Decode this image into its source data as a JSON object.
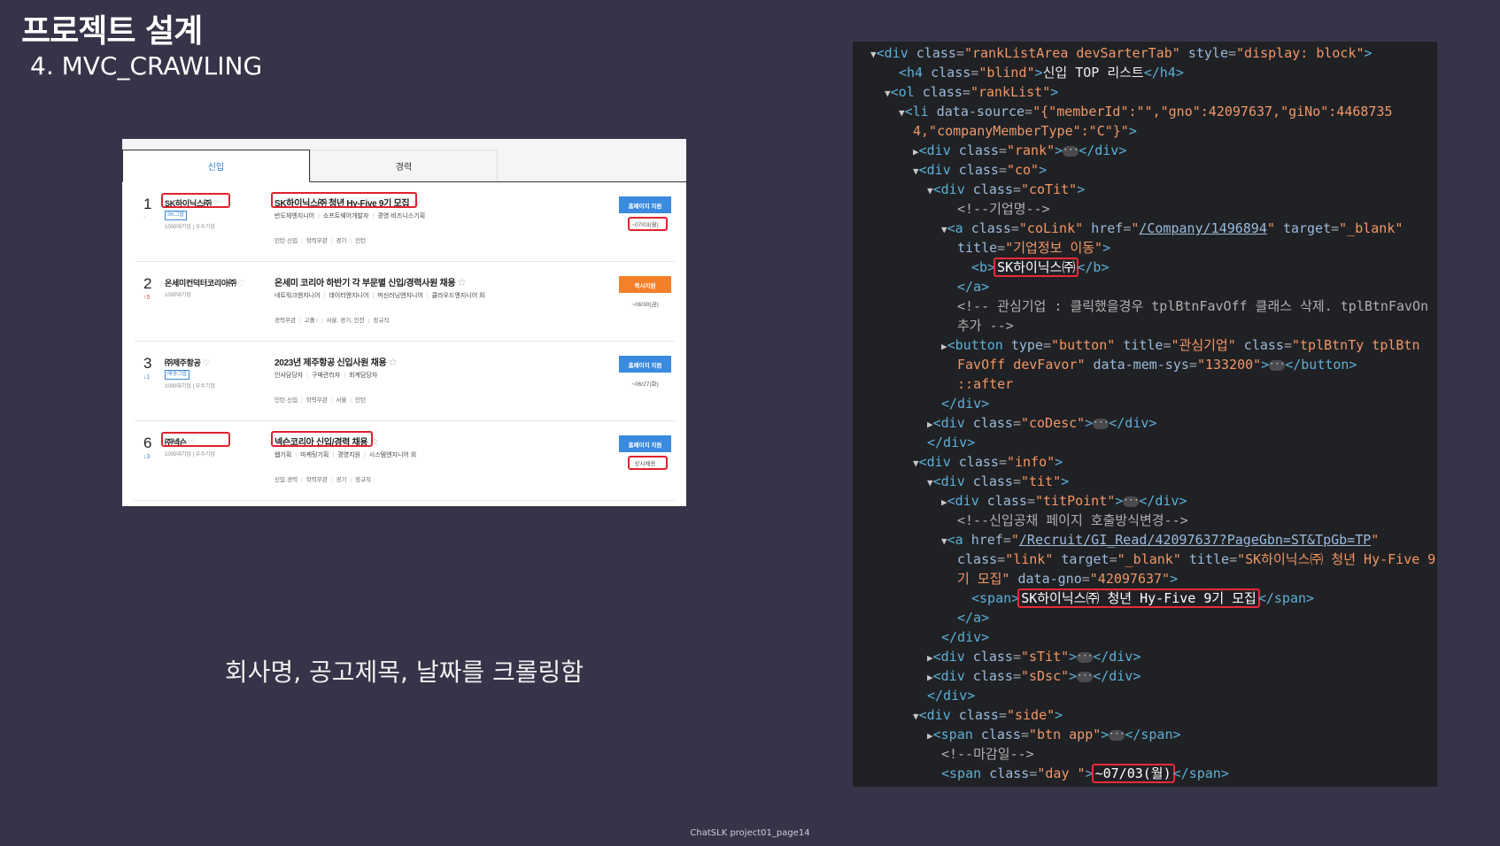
{
  "slide": {
    "title": "프로젝트 설계",
    "subtitle": "4. MVC_CRAWLING",
    "caption": "회사명, 공고제목, 날짜를 크롤링함",
    "footer": "ChatSLK project01_page14"
  },
  "listing": {
    "tabs": [
      {
        "label": "신입",
        "active": true
      },
      {
        "label": "경력",
        "active": false
      }
    ],
    "rows": [
      {
        "rank": "1",
        "change": "-",
        "company": "SK하이닉스㈜",
        "group_tag": "SK그룹",
        "company_meta": "1000대기업 | 우수기업",
        "title": "SK하이닉스㈜ 청년 Hy-Five 9기 모집",
        "sub": [
          "반도체엔지니어",
          "소프트웨어개발자",
          "경영·비즈니스기획"
        ],
        "conditions": [
          "인턴·신입",
          "학력무관",
          "경기",
          "인턴"
        ],
        "button": "홈페이지 지원",
        "deadline": "~07/03(월)"
      },
      {
        "rank": "2",
        "change": "↑5",
        "company": "온세미컨덕터코리아㈜",
        "group_tag": "",
        "company_meta": "1000대기업",
        "title": "온세미 코리아 하반기 각 부문별 신입/경력사원 채용",
        "sub": [
          "네트워크엔지니어",
          "데이터엔지니어",
          "머신러닝엔지니어",
          "클라우드엔지니어 외"
        ],
        "conditions": [
          "경력무관",
          "고졸↑",
          "서울, 경기, 인천",
          "정규직"
        ],
        "button": "즉시지원",
        "deadline": "~06/30(금)"
      },
      {
        "rank": "3",
        "change": "↓1",
        "company": "㈜제주항공",
        "group_tag": "애경그룹",
        "company_meta": "1000대기업 | 우수기업",
        "title": "2023년 제주항공 신입사원 채용",
        "sub": [
          "인사담당자",
          "구매관리자",
          "회계담당자"
        ],
        "conditions": [
          "인턴·신입",
          "학력무관",
          "서울",
          "인턴"
        ],
        "button": "홈페이지 지원",
        "deadline": "~06/27(화)"
      },
      {
        "rank": "6",
        "change": "↓3",
        "company": "㈜넥슨",
        "group_tag": "",
        "company_meta": "1000대기업 | 우수기업",
        "title": "넥슨코리아 신입/경력 채용",
        "sub": [
          "웹기획",
          "마케팅기획",
          "경영지원",
          "시스템엔지니어 외"
        ],
        "conditions": [
          "신입·경력",
          "학력무관",
          "경기",
          "정규직"
        ],
        "button": "홈페이지 지원",
        "deadline": "상시채용"
      }
    ]
  },
  "devtools": {
    "l1": {
      "tag_open": "<div ",
      "a1": "class",
      "v1": "\"rankListArea devSarterTab\"",
      "a2": "style",
      "v2": "\"display: block\"",
      "close": ">"
    },
    "l2": {
      "tag_open": "<h4 ",
      "a1": "class",
      "v1": "\"blind\"",
      "gt": ">",
      "text": "신입 TOP 리스트",
      "tag_close": "</h4>"
    },
    "l3": {
      "tag_open": "<ol ",
      "a1": "class",
      "v1": "\"rankList\"",
      "close": ">"
    },
    "l4": {
      "tag_open": "<li ",
      "a1": "data-source",
      "v1": "\"{\"memberId\":\"\",\"gno\":42097637,\"giNo\":4468735"
    },
    "l5": {
      "v1": "4,\"companyMemberType\":\"C\"}\"",
      "close": ">"
    },
    "l6": {
      "tag_open": "<div ",
      "a1": "class",
      "v1": "\"rank\"",
      "gt": ">",
      "ell": "···",
      "tag_close": "</div>"
    },
    "l7": {
      "tag_open": "<div ",
      "a1": "class",
      "v1": "\"co\"",
      "close": ">"
    },
    "l8": {
      "tag_open": "<div ",
      "a1": "class",
      "v1": "\"coTit\"",
      "close": ">"
    },
    "l9": {
      "comment": "<!--기업명-->"
    },
    "l10": {
      "tag_open": "<a ",
      "a1": "class",
      "v1": "\"coLink\"",
      "a2": "href",
      "q1": "\"",
      "link": "/Company/1496894",
      "q2": "\"",
      "a3": "target",
      "v3": "\"_blank\""
    },
    "l11": {
      "a1": "title",
      "v1": "\"기업정보 이동\"",
      "close": ">"
    },
    "l12": {
      "tag_open": "<b>",
      "text": "SK하이닉스㈜",
      "tag_close": "</b>"
    },
    "l13": {
      "tag_close": "</a>"
    },
    "l14": {
      "comment": "<!-- 관심기업 : 클릭했을경우 tplBtnFavOff 클래스 삭제. tplBtnFavOn"
    },
    "l15": {
      "comment": "추가 -->"
    },
    "l16": {
      "tag_open": "<button ",
      "a1": "type",
      "v1": "\"button\"",
      "a2": "title",
      "v2": "\"관심기업\"",
      "a3": "class",
      "v3": "\"tplBtnTy tplBtn"
    },
    "l17": {
      "v1": "FavOff devFavor\"",
      "a2": "data-mem-sys",
      "v2": "\"133200\"",
      "gt": ">",
      "ell": "···",
      "tag_close": "</button>"
    },
    "l18": {
      "pseudo": "::after"
    },
    "l19": {
      "tag_close": "</div>"
    },
    "l20": {
      "tag_open": "<div ",
      "a1": "class",
      "v1": "\"coDesc\"",
      "gt": ">",
      "ell": "···",
      "tag_close": "</div>"
    },
    "l21": {
      "tag_close": "</div>"
    },
    "l22": {
      "tag_open": "<div ",
      "a1": "class",
      "v1": "\"info\"",
      "close": ">"
    },
    "l23": {
      "tag_open": "<div ",
      "a1": "class",
      "v1": "\"tit\"",
      "close": ">"
    },
    "l24": {
      "tag_open": "<div ",
      "a1": "class",
      "v1": "\"titPoint\"",
      "gt": ">",
      "ell": "···",
      "tag_close": "</div>"
    },
    "l25": {
      "comment": "<!--신입공채 페이지 호출방식변경-->"
    },
    "l26": {
      "tag_open": "<a ",
      "a1": "href",
      "q1": "\"",
      "link": "/Recruit/GI_Read/42097637?PageGbn=ST&TpGb=TP",
      "q2": "\""
    },
    "l27": {
      "a1": "class",
      "v1": "\"link\"",
      "a2": "target",
      "v2": "\"_blank\"",
      "a3": "title",
      "v3": "\"SK하이닉스㈜ 청년 Hy-Five 9"
    },
    "l28": {
      "v1": "기 모집\"",
      "a2": "data-gno",
      "v2": "\"42097637\"",
      "close": ">"
    },
    "l29": {
      "tag_open": "<span>",
      "text": "SK하이닉스㈜ 청년 Hy-Five 9기 모집",
      "tag_close": "</span>"
    },
    "l30": {
      "tag_close": "</a>"
    },
    "l31": {
      "tag_close": "</div>"
    },
    "l32": {
      "tag_open": "<div ",
      "a1": "class",
      "v1": "\"sTit\"",
      "gt": ">",
      "ell": "···",
      "tag_close": "</div>"
    },
    "l33": {
      "tag_open": "<div ",
      "a1": "class",
      "v1": "\"sDsc\"",
      "gt": ">",
      "ell": "···",
      "tag_close": "</div>"
    },
    "l34": {
      "tag_close": "</div>"
    },
    "l35": {
      "tag_open": "<div ",
      "a1": "class",
      "v1": "\"side\"",
      "close": ">"
    },
    "l36": {
      "tag_open": "<span ",
      "a1": "class",
      "v1": "\"btn app\"",
      "gt": ">",
      "ell": "···",
      "tag_close": "</span>"
    },
    "l37": {
      "comment": "<!--마감일-->"
    },
    "l38": {
      "tag_open": "<span ",
      "a1": "class",
      "v1": "\"day \"",
      "gt": ">",
      "text": "~07/03(월)",
      "tag_close": "</span>"
    }
  },
  "colors": {
    "background": "#353448",
    "highlight": "#ea2a37",
    "apply_blue": "#3a8ae0",
    "apply_orange": "#f5802a"
  }
}
